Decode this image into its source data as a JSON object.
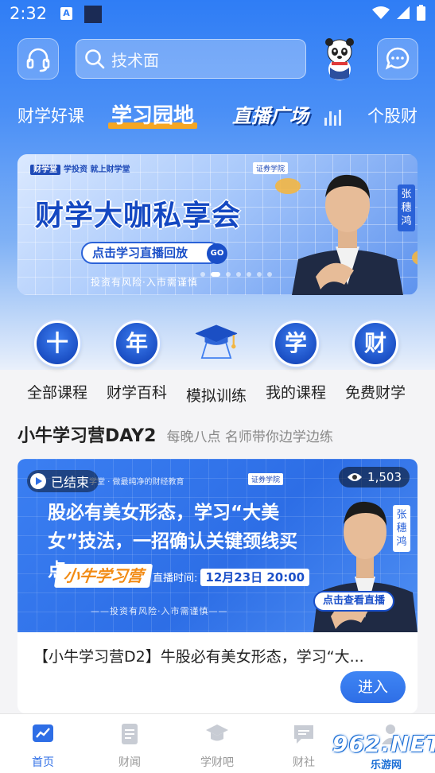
{
  "status_bar": {
    "time": "2:32",
    "notif_letter": "A"
  },
  "search": {
    "placeholder": "技术面"
  },
  "tabs": [
    {
      "label": "财学好课",
      "active": false
    },
    {
      "label": "学习园地",
      "active": true
    },
    {
      "label": "直播广场",
      "active": false
    },
    {
      "label": "个股财",
      "active": false
    }
  ],
  "banner": {
    "brand": "财学堂",
    "slogan": "学投资 就上财学堂",
    "tag": "证券学院",
    "title": "财学大咖私享会",
    "button_label": "点击学习直播回放",
    "go_label": "GO",
    "risk_text": "投资有风险·入市需谨慎",
    "person_name": "张穗鸿",
    "dot_count": 7,
    "active_dot": 1
  },
  "quick_icons": [
    {
      "glyph": "十",
      "label": "全部课程",
      "icon": "scroll-badge-icon"
    },
    {
      "glyph": "年",
      "label": "财学百科",
      "icon": "scroll-badge-icon"
    },
    {
      "glyph": "",
      "label": "模拟训练",
      "icon": "graduation-cap-icon"
    },
    {
      "glyph": "学",
      "label": "我的课程",
      "icon": "scroll-badge-icon"
    },
    {
      "glyph": "财",
      "label": "免费财学",
      "icon": "scroll-badge-icon"
    }
  ],
  "section": {
    "title": "小牛学习营DAY2",
    "subtitle": "每晚八点 名师带你边学边练"
  },
  "card": {
    "status": "已结束",
    "views": "1,503",
    "slogan": "学堂 · 做最纯净的财经教育",
    "tag": "证券学院",
    "headline": "股必有美女形态，学习“大美女”技法，一招确认关键颈线买点。",
    "camp_logo": "小牛学习营",
    "live_time_label": "直播时间:",
    "live_time_value": "12月23日 20:00",
    "risk_text": "——投资有风险·入市需谨慎——",
    "person_name": "张穗鸿",
    "watch_label": "点击查看直播",
    "title": "【小牛学习营D2】牛股必有美女形态，学习“大...",
    "enter_label": "进入"
  },
  "bottom_nav": [
    {
      "label": "首页",
      "active": true
    },
    {
      "label": "财闻",
      "active": false
    },
    {
      "label": "学财吧",
      "active": false
    },
    {
      "label": "财社",
      "active": false
    },
    {
      "label": "",
      "active": false
    }
  ],
  "watermark": {
    "main": "962.NET",
    "sub": "乐游网"
  },
  "colors": {
    "primary": "#2e6ee6",
    "accent": "#f5a623",
    "hero_top": "#2f7df5"
  }
}
